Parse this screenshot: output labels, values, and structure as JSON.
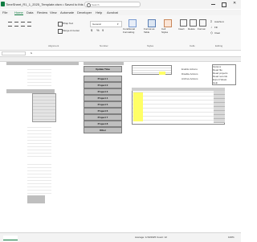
{
  "window": {
    "title": "TimeSheet_R1_1_2025_Template.xlsm • Saved to this PC",
    "search_placeholder": "Search"
  },
  "ribbon_tabs": [
    "File",
    "Home",
    "Data",
    "Review",
    "View",
    "Automate",
    "Developer",
    "Help",
    "Acrobat"
  ],
  "ribbon": {
    "wrap_text": "Wrap Text",
    "merge_center": "Merge & Center",
    "number_format": "General",
    "conditional_formatting": "Conditional Formatting",
    "format_as_table": "Format as Table",
    "cell_styles": "Cell Styles",
    "insert": "Insert",
    "delete": "Delete",
    "format": "Format",
    "autosum": "AutoSum",
    "fill": "Fill",
    "clear": "Clear",
    "groups": {
      "alignment": "Alignment",
      "number": "Number",
      "styles": "Styles",
      "cells": "Cells",
      "editing": "Editing"
    }
  },
  "buttons": {
    "update_time": "Update Time",
    "projects": [
      "Project 1",
      "Project 2",
      "Project 3",
      "Project 4",
      "Project 5",
      "Project 6",
      "Project 7",
      "Project 8"
    ],
    "other": "Other"
  },
  "side_labels": [
    "Enable Actions",
    "Disable Actions",
    "Archive Actions"
  ],
  "list_labels": [
    "Options",
    "Read file",
    "Read projects",
    "Read records",
    "Export Week",
    "Help"
  ],
  "status": {
    "summary": "Average: 1/16/2025  Count: 12",
    "zoom": "100%"
  }
}
